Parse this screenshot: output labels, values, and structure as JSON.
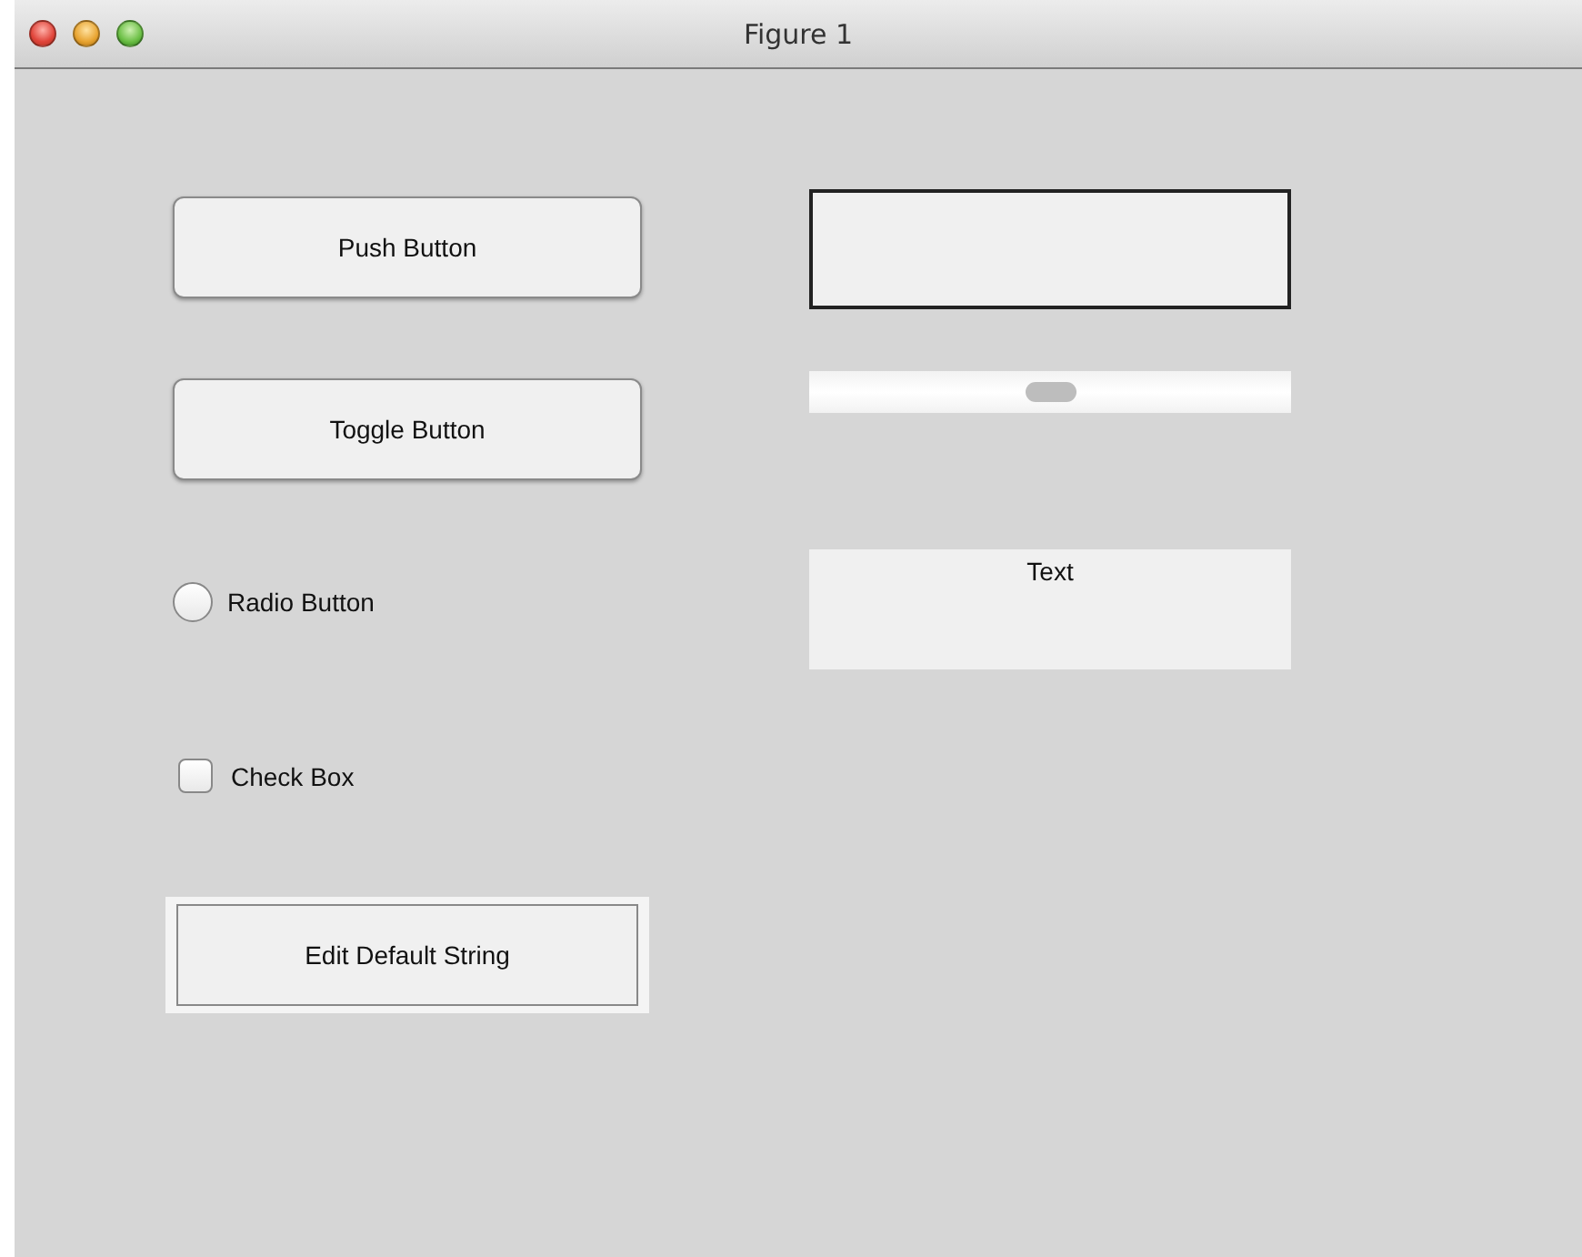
{
  "window": {
    "title": "Figure 1"
  },
  "push_button": {
    "label": "Push Button"
  },
  "toggle_button": {
    "label": "Toggle Button",
    "selected": false
  },
  "radio_button": {
    "label": "Radio Button",
    "selected": false
  },
  "check_box": {
    "label": "Check Box",
    "checked": false
  },
  "edit_field": {
    "value": "Edit Default String"
  },
  "slider": {
    "level": 0.5
  },
  "static_text": {
    "text": "Text"
  }
}
